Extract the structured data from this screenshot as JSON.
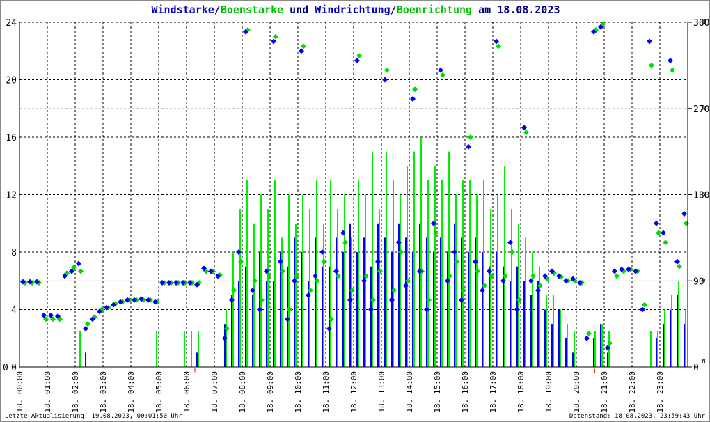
{
  "title": {
    "part1": "Windstarke",
    "sep1": "/",
    "part2": "Boenstarke",
    "mid": " und ",
    "part3": "Windrichtung",
    "sep2": "/",
    "part4": "Boenrichtung",
    "tail": " am 18.08.2023"
  },
  "footer": {
    "left": "Letzte Aktualisierung: 19.08.2023, 00:01:50 Uhr",
    "right": "Datenstand: 18.08.2023, 23:59:43 Uhr"
  },
  "colors": {
    "speed": "#0000ff",
    "gust": "#00ee00",
    "dir": "#0000ff",
    "gustdir": "#00dd00",
    "marker": "#ff0000"
  },
  "chart_data": {
    "type": "bar",
    "title": "Windstarke/Boenstarke und Windrichtung/Boenrichtung am 18.08.2023",
    "x_tick_labels": [
      "18. 00:00",
      "18. 01:00",
      "18. 02:00",
      "18. 03:00",
      "18. 04:00",
      "18. 05:00",
      "18. 06:00",
      "18. 07:00",
      "18. 08:00",
      "18. 09:00",
      "18. 10:00",
      "18. 11:00",
      "18. 12:00",
      "18. 13:00",
      "18. 14:00",
      "18. 15:00",
      "18. 16:00",
      "18. 17:00",
      "18. 18:00",
      "18. 19:00",
      "18. 20:00",
      "18. 21:00",
      "18. 22:00",
      "18. 23:00"
    ],
    "ylim": [
      0,
      24
    ],
    "y_ticks": [
      "0",
      "4",
      "8",
      "12",
      "16",
      "20",
      "24"
    ],
    "y2lim": [
      0,
      360
    ],
    "y2_ticks": [
      "0",
      "90",
      "180",
      "270",
      "360"
    ],
    "y2_compass": [
      "N",
      "O",
      "S",
      "W",
      "N"
    ],
    "left_axis_zero": "0",
    "markers": [
      {
        "label": "A",
        "hour": 6.3
      },
      {
        "label": "U",
        "hour": 20.7
      }
    ],
    "interval_minutes": 15,
    "series": [
      {
        "name": "Windstarke",
        "kind": "bar",
        "values": [
          0,
          0,
          0,
          0,
          0,
          0,
          0,
          0,
          0,
          1,
          0,
          0,
          0,
          0,
          0,
          0,
          0,
          0,
          0,
          0,
          0,
          0,
          0,
          0,
          0,
          1,
          0,
          0,
          0,
          3,
          5,
          6,
          7,
          5,
          8,
          6,
          6,
          8,
          7,
          9,
          8,
          6,
          9,
          7,
          7,
          9,
          8,
          10,
          8,
          9,
          7,
          10,
          9,
          8,
          10,
          9,
          8,
          10,
          9,
          8,
          9,
          8,
          10,
          9,
          8,
          9,
          8,
          7,
          8,
          7,
          6,
          7,
          6,
          5,
          6,
          4,
          3,
          4,
          2,
          1,
          0,
          0,
          2,
          3,
          1,
          0,
          0,
          0,
          0,
          0,
          0,
          2,
          3,
          4,
          5,
          3
        ]
      },
      {
        "name": "Boenstarke",
        "kind": "bar",
        "values": [
          0,
          0,
          0,
          0,
          0,
          0,
          0,
          0,
          2.5,
          0,
          0,
          0,
          0,
          0,
          0,
          0,
          0,
          0,
          0,
          2.5,
          0,
          0,
          0,
          2.5,
          2.5,
          2.5,
          0,
          0,
          0,
          4,
          8,
          11,
          13,
          10,
          12,
          11,
          13,
          9,
          12,
          10,
          12,
          11,
          13,
          10,
          13,
          11,
          12,
          9,
          13,
          12,
          15,
          11,
          15,
          13,
          12,
          14,
          15,
          16,
          13,
          14,
          13,
          15,
          12,
          13,
          13,
          12,
          13,
          11,
          12,
          14,
          11,
          10,
          9,
          8,
          7,
          5,
          5,
          4,
          3,
          2.5,
          0,
          0,
          2.5,
          3,
          2.5,
          0,
          0,
          0,
          0,
          0,
          2.5,
          2.5,
          4,
          5,
          6,
          4
        ]
      },
      {
        "name": "Windrichtung",
        "kind": "scatter",
        "values": [
          89,
          89,
          89,
          54,
          54,
          53,
          95,
          100,
          108,
          40,
          50,
          58,
          62,
          65,
          68,
          70,
          70,
          71,
          70,
          68,
          88,
          88,
          88,
          88,
          88,
          86,
          103,
          100,
          95,
          30,
          70,
          120,
          350,
          80,
          60,
          100,
          340,
          110,
          50,
          90,
          330,
          75,
          95,
          120,
          40,
          100,
          140,
          70,
          320,
          90,
          60,
          110,
          300,
          70,
          130,
          85,
          280,
          100,
          60,
          150,
          310,
          90,
          120,
          70,
          230,
          110,
          80,
          100,
          340,
          90,
          130,
          60,
          250,
          90,
          80,
          95,
          100,
          95,
          90,
          92,
          88,
          30,
          350,
          355,
          20,
          100,
          102,
          102,
          100,
          60,
          340,
          150,
          140,
          320,
          110,
          160
        ]
      },
      {
        "name": "Boenrichtung",
        "kind": "scatter",
        "values": [
          88,
          88,
          88,
          50,
          50,
          50,
          98,
          104,
          100,
          45,
          52,
          60,
          62,
          66,
          68,
          70,
          70,
          70,
          70,
          68,
          88,
          88,
          88,
          88,
          88,
          88,
          100,
          100,
          96,
          40,
          80,
          110,
          352,
          90,
          70,
          95,
          345,
          100,
          60,
          95,
          335,
          80,
          90,
          110,
          50,
          95,
          130,
          80,
          325,
          95,
          70,
          100,
          310,
          80,
          120,
          90,
          290,
          100,
          70,
          140,
          305,
          95,
          110,
          80,
          240,
          100,
          85,
          95,
          335,
          95,
          120,
          70,
          245,
          95,
          85,
          92,
          98,
          94,
          90,
          90,
          88,
          35,
          352,
          358,
          25,
          95,
          100,
          102,
          100,
          65,
          315,
          140,
          130,
          310,
          105,
          150
        ]
      }
    ]
  }
}
